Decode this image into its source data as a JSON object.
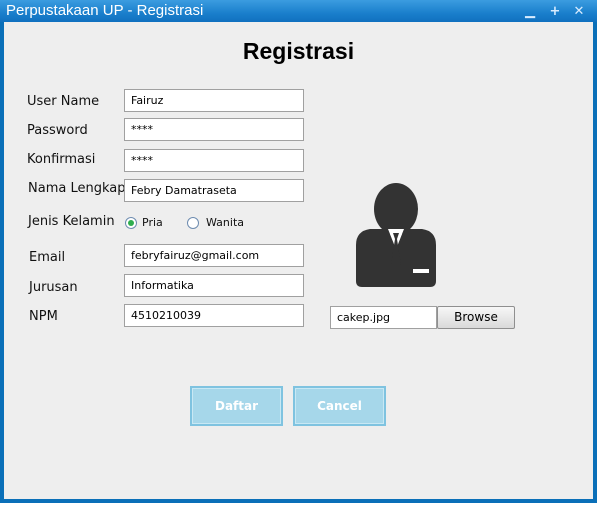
{
  "window": {
    "title": "Perpustakaan UP - Registrasi",
    "controls": {
      "minimize": "▁",
      "maximize": "+",
      "close": "✕"
    }
  },
  "form": {
    "heading": "Registrasi",
    "username": {
      "label": "User Name",
      "value": "Fairuz"
    },
    "password": {
      "label": "Password",
      "value": "****"
    },
    "confirm": {
      "label": "Konfirmasi",
      "value": "****"
    },
    "fullname": {
      "label": "Nama Lengkap",
      "value": "Febry Damatraseta"
    },
    "gender": {
      "label": "Jenis Kelamin",
      "options": [
        "Pria",
        "Wanita"
      ],
      "selected": "Pria"
    },
    "email": {
      "label": "Email",
      "value": "febryfairuz@gmail.com"
    },
    "major": {
      "label": "Jurusan",
      "value": "Informatika"
    },
    "npm": {
      "label": "NPM",
      "value": "4510210039"
    }
  },
  "photo": {
    "icon": "user-avatar-icon",
    "filename": "cakep.jpg",
    "browse_label": "Browse"
  },
  "actions": {
    "submit_label": "Daftar",
    "cancel_label": "Cancel"
  },
  "colors": {
    "titlebar": "#1a7fcc",
    "panel": "#eeeeee",
    "action_button": "#a6d7ea",
    "radio_selected": "#2fae4f",
    "avatar": "#333333"
  }
}
